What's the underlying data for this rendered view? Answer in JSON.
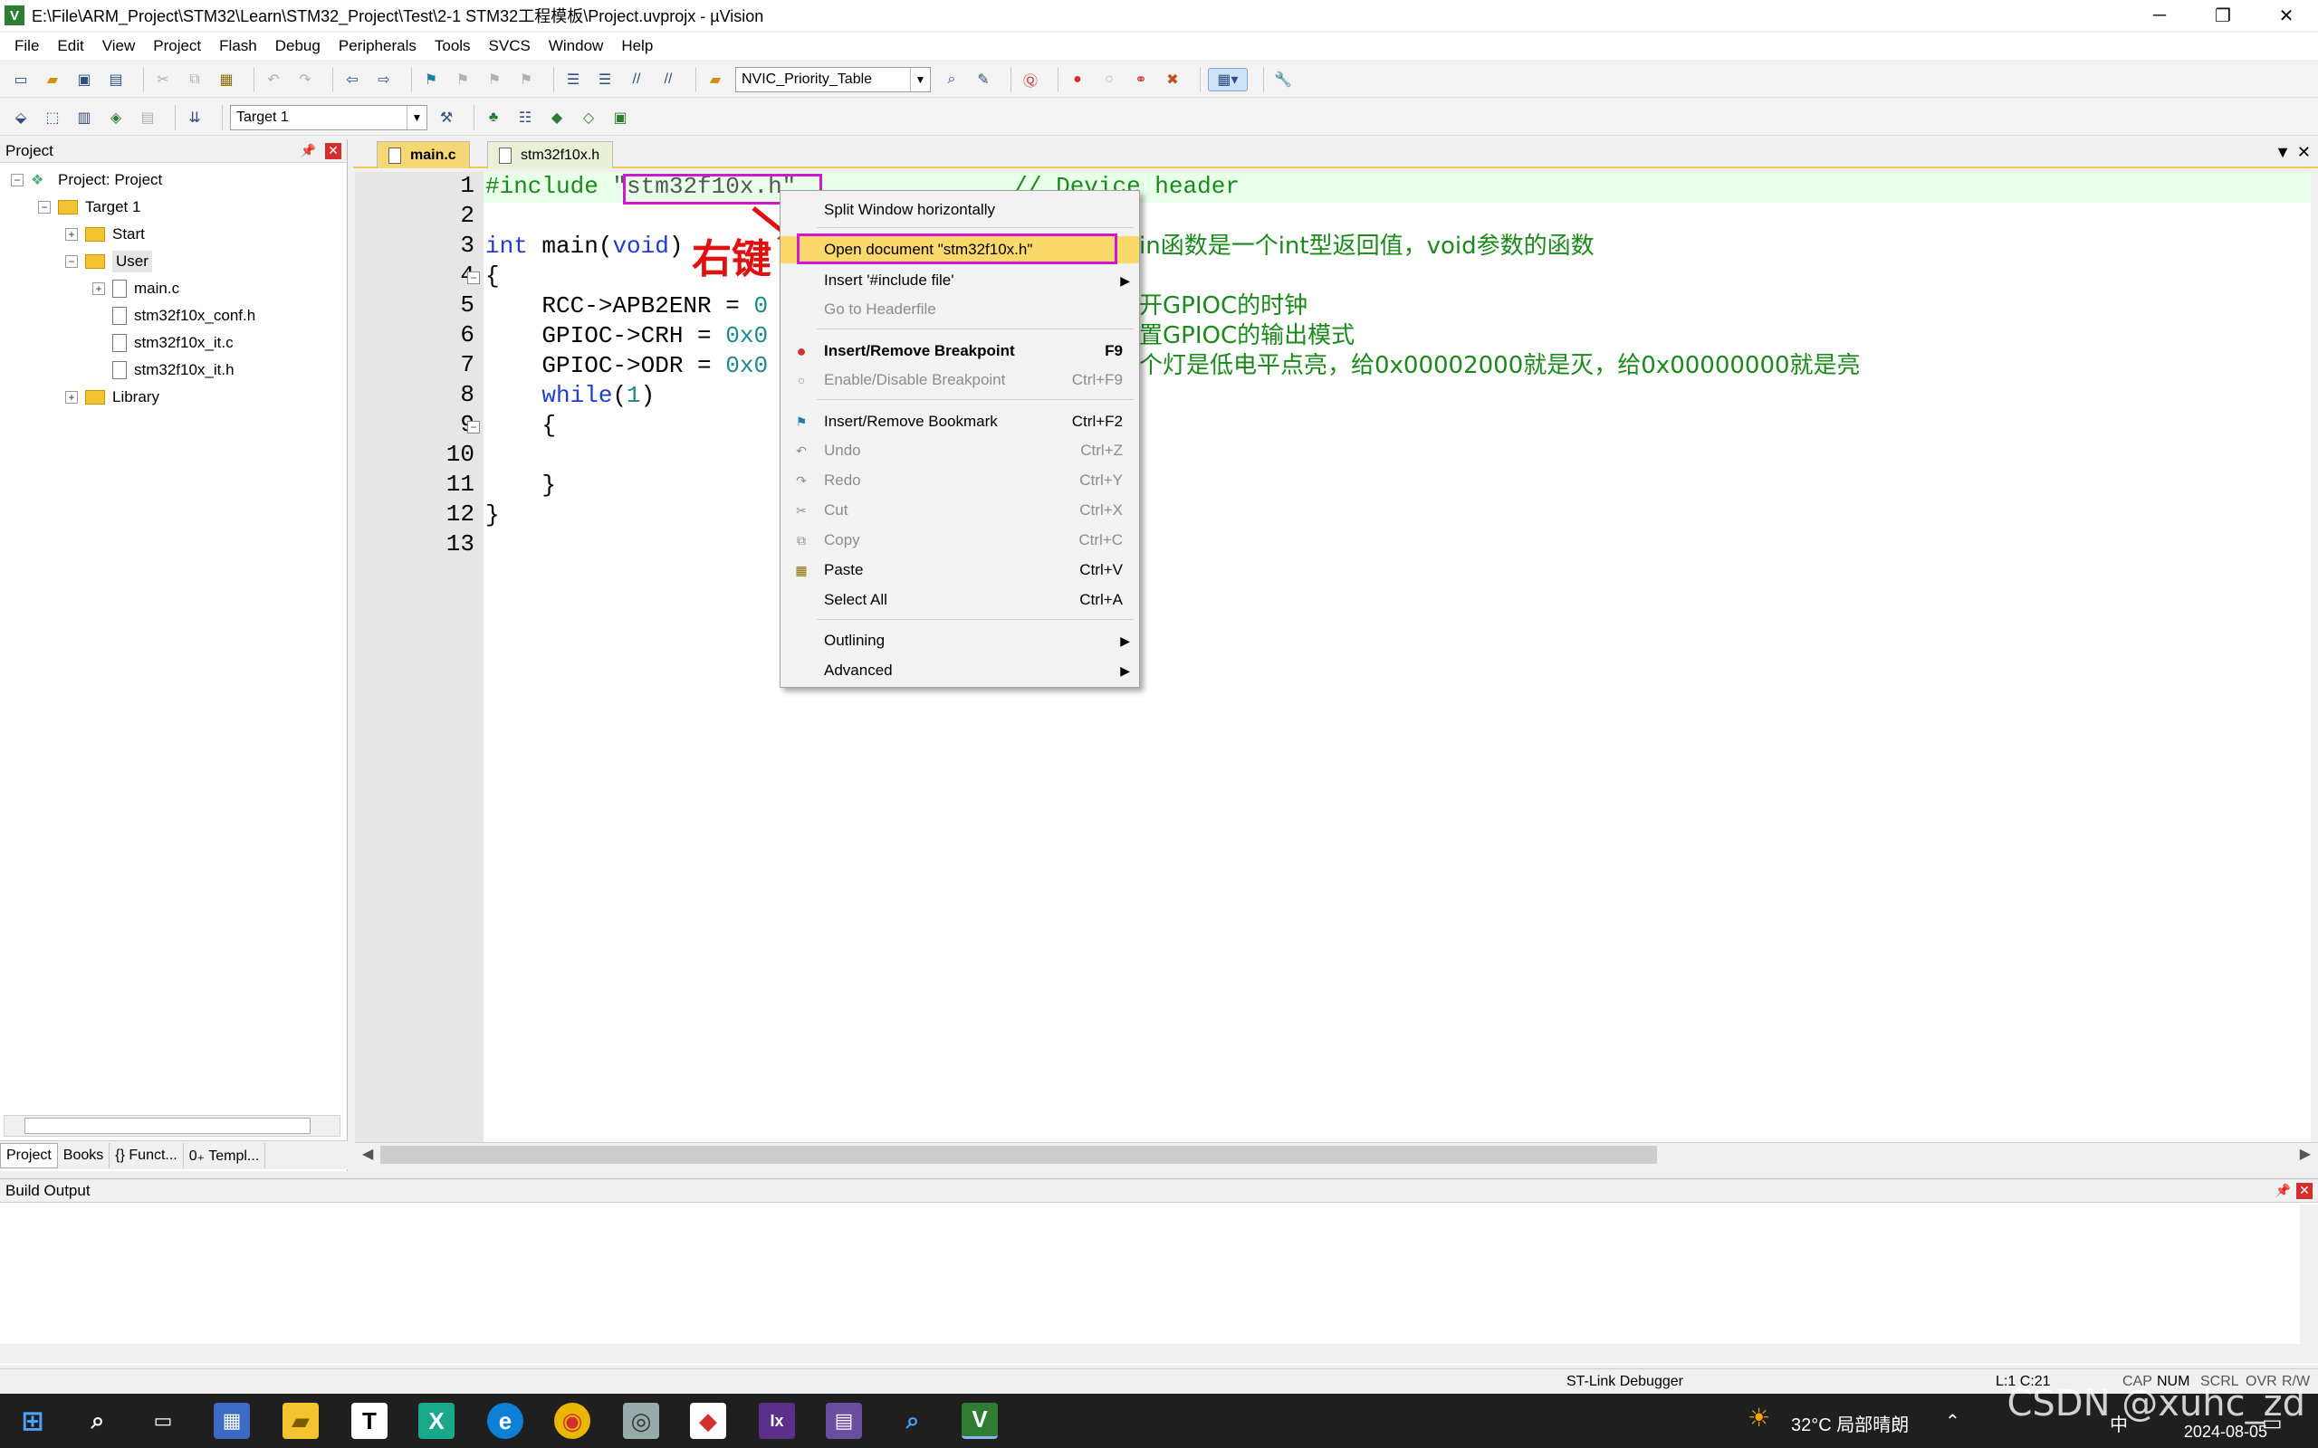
{
  "window": {
    "title": "E:\\File\\ARM_Project\\STM32\\Learn\\STM32_Project\\Test\\2-1 STM32工程模板\\Project.uvprojx - µVision",
    "minimize": "─",
    "maximize": "❐",
    "close": "✕"
  },
  "menu": [
    "File",
    "Edit",
    "View",
    "Project",
    "Flash",
    "Debug",
    "Peripherals",
    "Tools",
    "SVCS",
    "Window",
    "Help"
  ],
  "toolbar1": {
    "find_combo": "NVIC_Priority_Table"
  },
  "toolbar2": {
    "target_combo": "Target 1"
  },
  "project_panel": {
    "title": "Project",
    "tree": {
      "root": "Project: Project",
      "target": "Target 1",
      "groups": [
        "Start",
        "User",
        "Library"
      ],
      "user_files": [
        "main.c",
        "stm32f10x_conf.h",
        "stm32f10x_it.c",
        "stm32f10x_it.h"
      ]
    },
    "tabs": [
      "Project",
      "Books",
      "{} Funct...",
      "0₊ Templ..."
    ]
  },
  "editor": {
    "tabs": [
      "main.c",
      "stm32f10x.h"
    ],
    "line_numbers": [
      "1",
      "2",
      "3",
      "4",
      "5",
      "6",
      "7",
      "8",
      "9",
      "10",
      "11",
      "12",
      "13"
    ],
    "lines": {
      "l1_directive": "#include ",
      "l1_string": "\"stm32f10x.h\"",
      "l1_comment": "// Device header",
      "l3_kw": "int",
      "l3_fn": " main(",
      "l3_kw2": "void",
      "l3_close": ")",
      "l3_comment": "in函数是一个int型返回值，void参数的函数",
      "l4": "{",
      "l5_code": "    RCC->APB2ENR = ",
      "l5_num": "0",
      "l5_comment": "开GPIOC的时钟",
      "l6_code": "    GPIOC->CRH = ",
      "l6_num": "0x0",
      "l6_comment": "置GPIOC的输出模式",
      "l7_code": "    GPIOC->ODR = ",
      "l7_num": "0x0",
      "l7_comment": "个灯是低电平点亮，给0x00002000就是灭，给0x00000000就是亮",
      "l8_kw": "    while",
      "l8_open": "(",
      "l8_num": "1",
      "l8_close": ")",
      "l9": "    {",
      "l11": "    }",
      "l12": "}"
    }
  },
  "annotation": {
    "text": "右键"
  },
  "context_menu": {
    "items": [
      {
        "label": "Split Window horizontally",
        "shortcut": ""
      },
      {
        "label": "Open document \"stm32f10x.h\"",
        "shortcut": ""
      },
      {
        "label": "Insert '#include file'",
        "shortcut": ""
      },
      {
        "label": "Go to Headerfile",
        "shortcut": ""
      },
      {
        "label": "Insert/Remove Breakpoint",
        "shortcut": "F9"
      },
      {
        "label": "Enable/Disable Breakpoint",
        "shortcut": "Ctrl+F9"
      },
      {
        "label": "Insert/Remove Bookmark",
        "shortcut": "Ctrl+F2"
      },
      {
        "label": "Undo",
        "shortcut": "Ctrl+Z"
      },
      {
        "label": "Redo",
        "shortcut": "Ctrl+Y"
      },
      {
        "label": "Cut",
        "shortcut": "Ctrl+X"
      },
      {
        "label": "Copy",
        "shortcut": "Ctrl+C"
      },
      {
        "label": "Paste",
        "shortcut": "Ctrl+V"
      },
      {
        "label": "Select All",
        "shortcut": "Ctrl+A"
      },
      {
        "label": "Outlining",
        "shortcut": ""
      },
      {
        "label": "Advanced",
        "shortcut": ""
      }
    ]
  },
  "build_output": {
    "title": "Build Output"
  },
  "statusbar": {
    "debugger": "ST-Link Debugger",
    "position": "L:1 C:21",
    "indicators": [
      "CAP",
      "NUM",
      "SCRL",
      "OVR",
      "R/W"
    ]
  },
  "taskbar": {
    "weather": "32°C 局部晴朗",
    "date": "2024-08-05",
    "ime": "中"
  },
  "watermark": "CSDN @xuhc_zd",
  "colors": {
    "accent_tab": "#f7d774",
    "highlight_box": "#d515d5",
    "annotation": "#e01010",
    "menu_highlight": "#fbd86a"
  }
}
